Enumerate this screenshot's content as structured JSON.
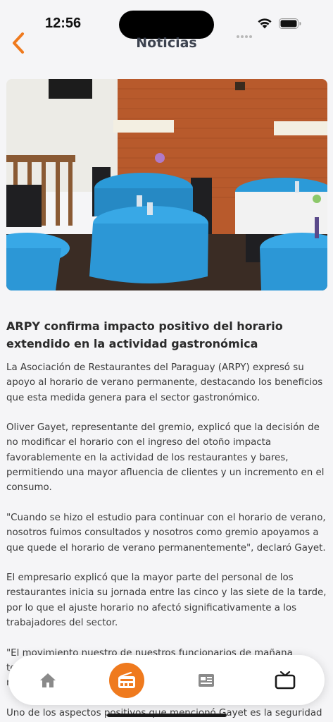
{
  "status_bar": {
    "time": "12:56",
    "icons": [
      "signal-dots-icon",
      "wifi-icon",
      "battery-icon"
    ]
  },
  "header": {
    "title": "Noticias",
    "back_icon": "chevron-left-icon",
    "accent_color": "#ef7a1e"
  },
  "hero_image": {
    "description_icon": "restaurant-photo"
  },
  "article": {
    "headline": "ARPY confirma impacto positivo del horario extendido en la actividad gastronómica",
    "paragraphs": [
      "La Asociación de Restaurantes del Paraguay (ARPY) expresó su apoyo al horario de verano permanente, destacando los beneficios que esta medida genera para el sector gastronómico.",
      "Oliver Gayet, representante del gremio, explicó que la decisión de no modificar el horario con el ingreso del otoño impacta favorablemente en la actividad de los restaurantes y bares, permitiendo una mayor afluencia de clientes y un incremento en el consumo.",
      "\"Cuando se hizo el estudio para continuar con el horario de verano, nosotros fuimos consultados y nosotros como gremio apoyamos a que quede el horario de verano permanentemente\", declaró Gayet.",
      "El empresario explicó que la mayor parte del personal de los restaurantes inicia su jornada entre las cinco y las siete de la tarde, por lo que el ajuste horario no afectó significativamente a los trabajadores del sector.",
      "\"El movimiento nuestro de nuestros funcionarios de mañana temprano no se vio afectado, y en el caso de los trabajadores nocturnos los ajustes fueron mínimos\", añadió.",
      "Uno de los aspectos positivos que mencionó Gayet es la seguridad"
    ]
  },
  "bottom_nav": {
    "items": [
      {
        "name": "home",
        "icon": "home-icon",
        "active": false
      },
      {
        "name": "radio",
        "icon": "radio-icon",
        "active": true
      },
      {
        "name": "news",
        "icon": "newspaper-icon",
        "active": false
      },
      {
        "name": "tv",
        "icon": "tv-icon",
        "active": false
      }
    ],
    "active_color": "#ef7a1e",
    "inactive_color": "#8a8a8a"
  }
}
